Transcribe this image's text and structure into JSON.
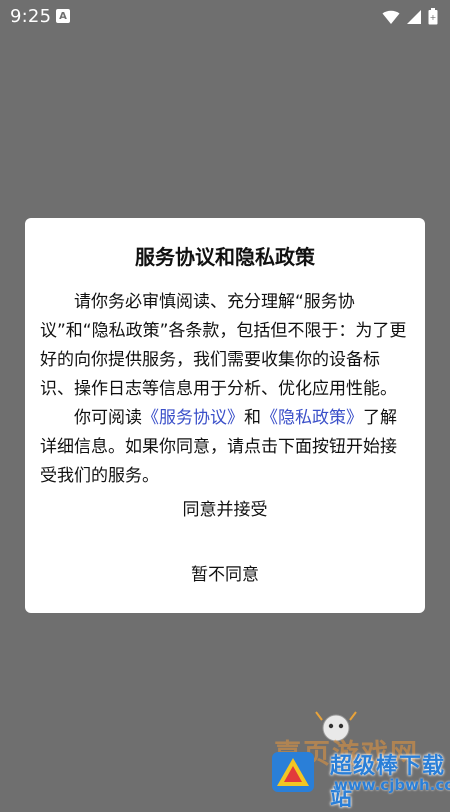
{
  "status_bar": {
    "time": "9:25",
    "notification_glyph": "A",
    "icons": [
      "notification-a-icon",
      "wifi-icon",
      "cellular-signal-icon",
      "battery-icon"
    ]
  },
  "dialog": {
    "title": "服务协议和隐私政策",
    "paragraph1": "请你务必审慎阅读、充分理解“服务协议”和“隐私政策”各条款，包括但不限于：为了更好的向你提供服务，我们需要收集你的设备标识、操作日志等信息用于分析、优化应用性能。",
    "paragraph2_prefix": "你可阅读",
    "link_service": "《服务协议》",
    "paragraph2_and": "和",
    "link_privacy": "《隐私政策》",
    "paragraph2_suffix": "了解详细信息。如果你同意，请点击下面按钮开始接受我们的服务。",
    "accept_label": "同意并接受",
    "decline_label": "暂不同意"
  },
  "watermark": {
    "site_text": "嘉页游戏网",
    "brand_text": "超级棒下载站",
    "url_text": "www.cjbwh.com"
  },
  "colors": {
    "overlay_background": "#6f6f6f",
    "dialog_background": "#ffffff",
    "link": "#3b50c9",
    "watermark_blue": "#2a7fd8"
  }
}
